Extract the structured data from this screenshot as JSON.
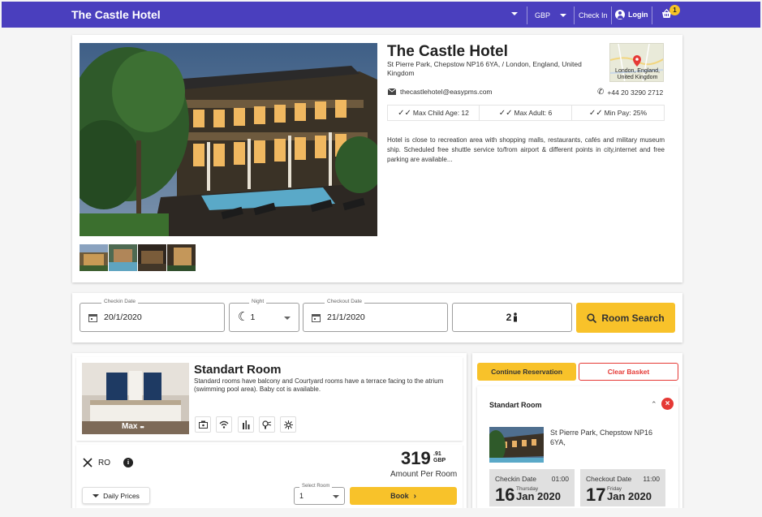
{
  "topbar": {
    "brand": "The Castle Hotel",
    "currency": "GBP",
    "check_in": "Check In",
    "login": "Login",
    "cart_count": "1",
    "bg_color": "#4a3fbe"
  },
  "hotel": {
    "name": "The Castle Hotel",
    "address": "St Pierre Park, Chepstow NP16 6YA, / London, England, United Kingdom",
    "map_label": "London, England, United Kingdom",
    "email": "thecastlehotel@easypms.com",
    "phone": "+44 20 3290 2712",
    "features": [
      "Max Child Age: 12",
      "Max Adult: 6",
      "Min Pay: 25%"
    ],
    "description": "Hotel is close to recreation area with shopping malls, restaurants, cafés and military museum ship. Scheduled free shuttle service to/from airport & different points in city,internet and free parking are available..."
  },
  "search": {
    "checkin_label": "Checkin Date",
    "checkin_value": "20/1/2020",
    "night_label": "Night",
    "night_value": "1",
    "checkout_label": "Checkout Date",
    "checkout_value": "21/1/2020",
    "guests_value": "2",
    "button_label": "Room Search",
    "accent_color": "#f8c22a"
  },
  "room": {
    "title": "Standart Room",
    "description": "Standard rooms have balcony and Courtyard rooms have a terrace facing to the atrium (swimming pool area). Baby cot is available.",
    "max_label": "Max",
    "amenity_icons": [
      "safe-box-icon",
      "wifi-icon",
      "minibar-icon",
      "hairdryer-icon",
      "air-conditioner-icon"
    ],
    "meal_plan": "RO",
    "price_main": "319",
    "price_decimals": ".91",
    "price_currency": "GBP",
    "price_label": "Amount Per Room",
    "daily_prices_label": "Daily Prices",
    "select_room_label": "Select Room",
    "select_room_value": "1",
    "book_label": "Book"
  },
  "basket": {
    "continue_label": "Continue Reservation",
    "clear_label": "Clear Basket",
    "room_title": "Standart Room",
    "address": "St Pierre Park, Chepstow NP16 6YA,",
    "checkin": {
      "label": "Checkin Date",
      "time": "01:00",
      "day": "16",
      "weekday": "Thursday",
      "month_year": "Jan 2020"
    },
    "checkout": {
      "label": "Checkout Date",
      "time": "11:00",
      "day": "17",
      "weekday": "Friday",
      "month_year": "Jan 2020"
    },
    "danger_color": "#e53935"
  }
}
